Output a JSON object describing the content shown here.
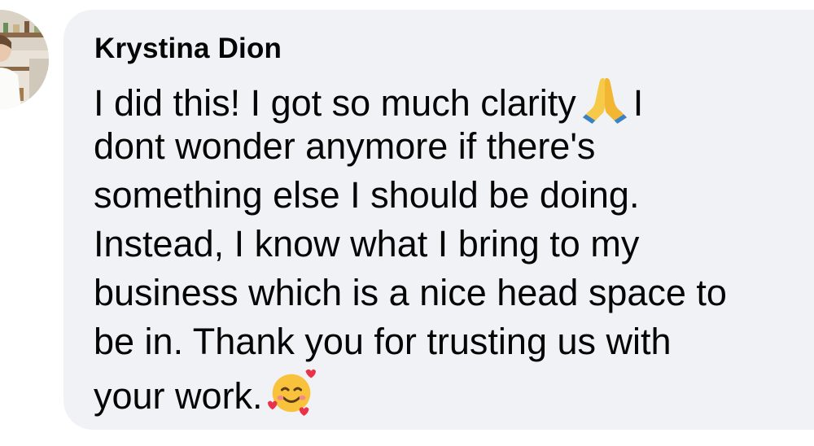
{
  "comment": {
    "author": "Krystina Dion",
    "avatar_icon": "profile-photo",
    "lines": [
      {
        "before": "I did this! I got so much clarity",
        "emoji": "folded-hands-emoji",
        "after": "I"
      },
      {
        "text": "dont wonder anymore if there's"
      },
      {
        "text": "something else I should be doing."
      },
      {
        "text": "Instead, I know what I bring to my"
      },
      {
        "text": "business which is a nice head space to"
      },
      {
        "text": "be in. Thank you for trusting us with"
      },
      {
        "before": "your work.",
        "emoji": "smiling-face-with-hearts-emoji"
      }
    ]
  },
  "colors": {
    "bubble_bg": "#f0f2f5",
    "text": "#050505",
    "page_bg": "#ffffff"
  }
}
